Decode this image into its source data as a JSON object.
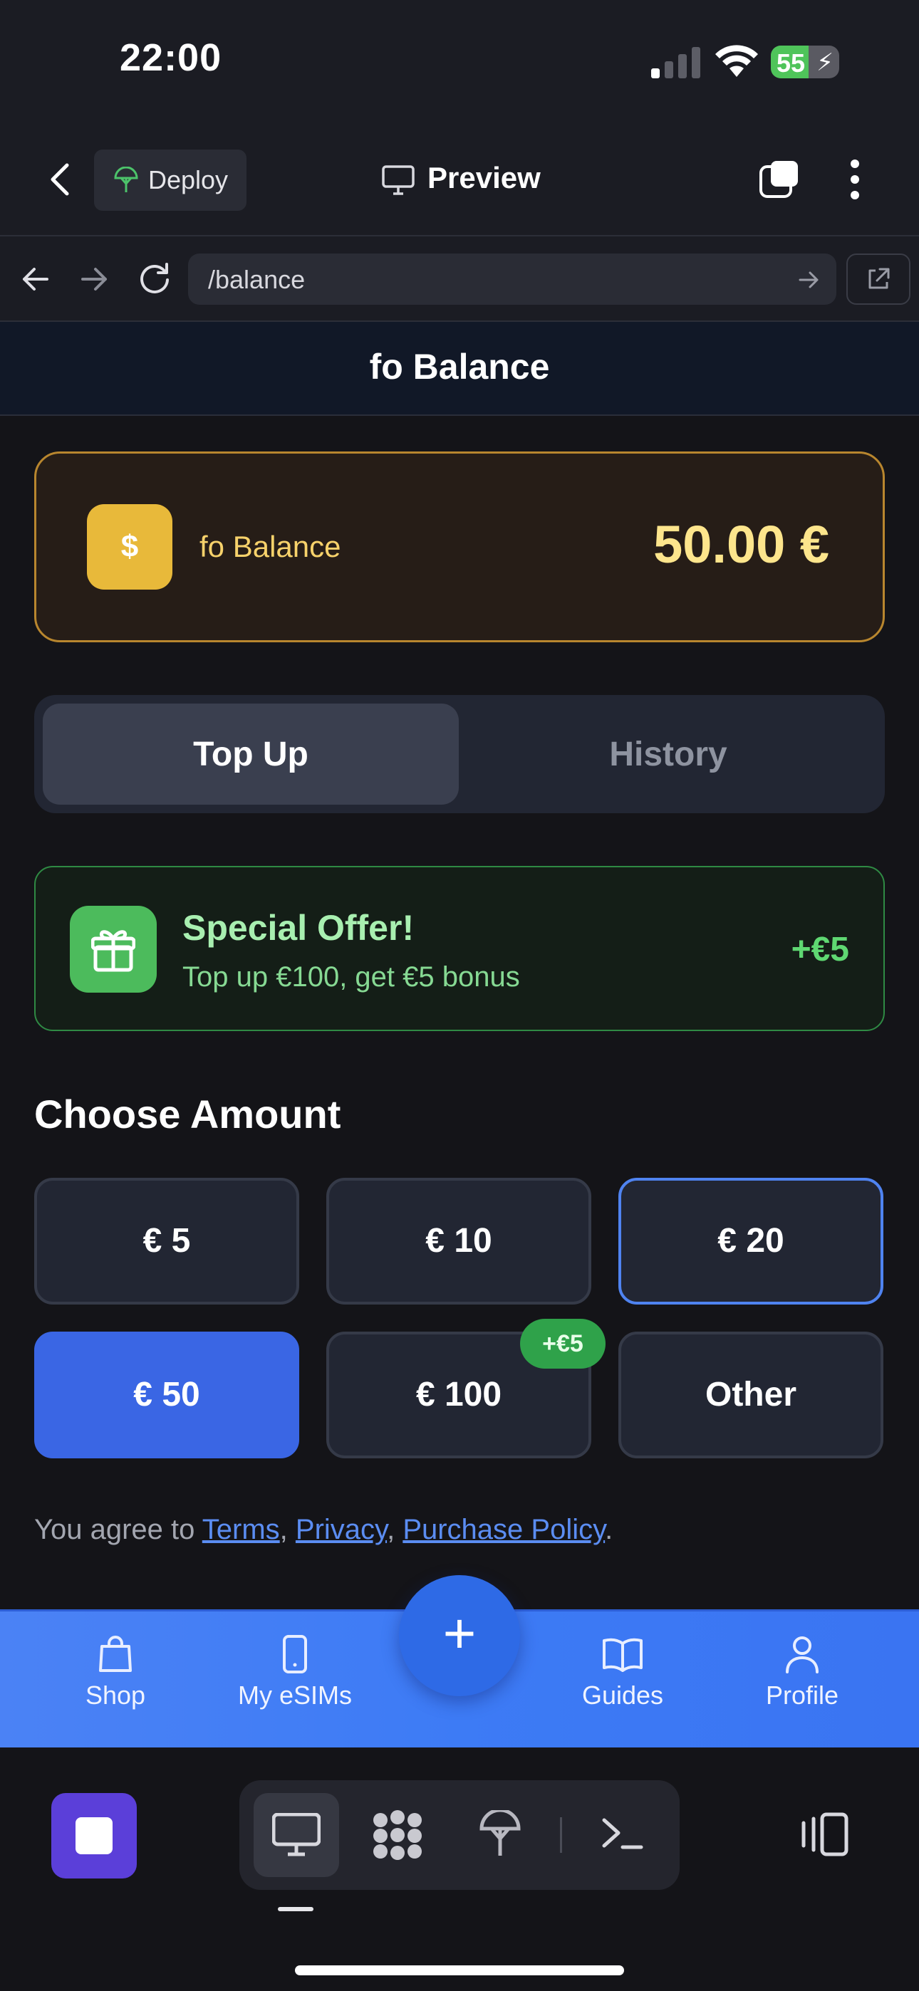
{
  "status_bar": {
    "time": "22:00",
    "battery": "55"
  },
  "header": {
    "deploy_label": "Deploy",
    "preview_label": "Preview"
  },
  "browser": {
    "url": "/balance"
  },
  "page": {
    "title": "fo Balance"
  },
  "balance": {
    "icon_glyph": "$",
    "label": "fo Balance",
    "value": "50.00 €"
  },
  "tabs": {
    "top_up": "Top Up",
    "history": "History",
    "active": "Top Up"
  },
  "offer": {
    "title": "Special Offer!",
    "subtitle": "Top up €100, get €5 bonus",
    "bonus": "+€5"
  },
  "amounts": {
    "title": "Choose Amount",
    "options": [
      "€ 5",
      "€ 10",
      "€ 20",
      "€ 50",
      "€ 100",
      "Other"
    ],
    "highlighted": "€ 20",
    "selected": "€ 50",
    "bonus_badge": "+€5"
  },
  "agreement": {
    "prefix": "You agree to ",
    "terms": "Terms",
    "sep": ", ",
    "privacy": "Privacy",
    "sep2": ", ",
    "policy": "Purchase Policy",
    "suffix": "."
  },
  "bottom_nav": {
    "shop": "Shop",
    "esims": "My eSIMs",
    "fab": "+",
    "guides": "Guides",
    "profile": "Profile"
  },
  "colors": {
    "accent": "#3a66e4",
    "gold": "#e8b93a",
    "success": "#4cbb5c"
  }
}
